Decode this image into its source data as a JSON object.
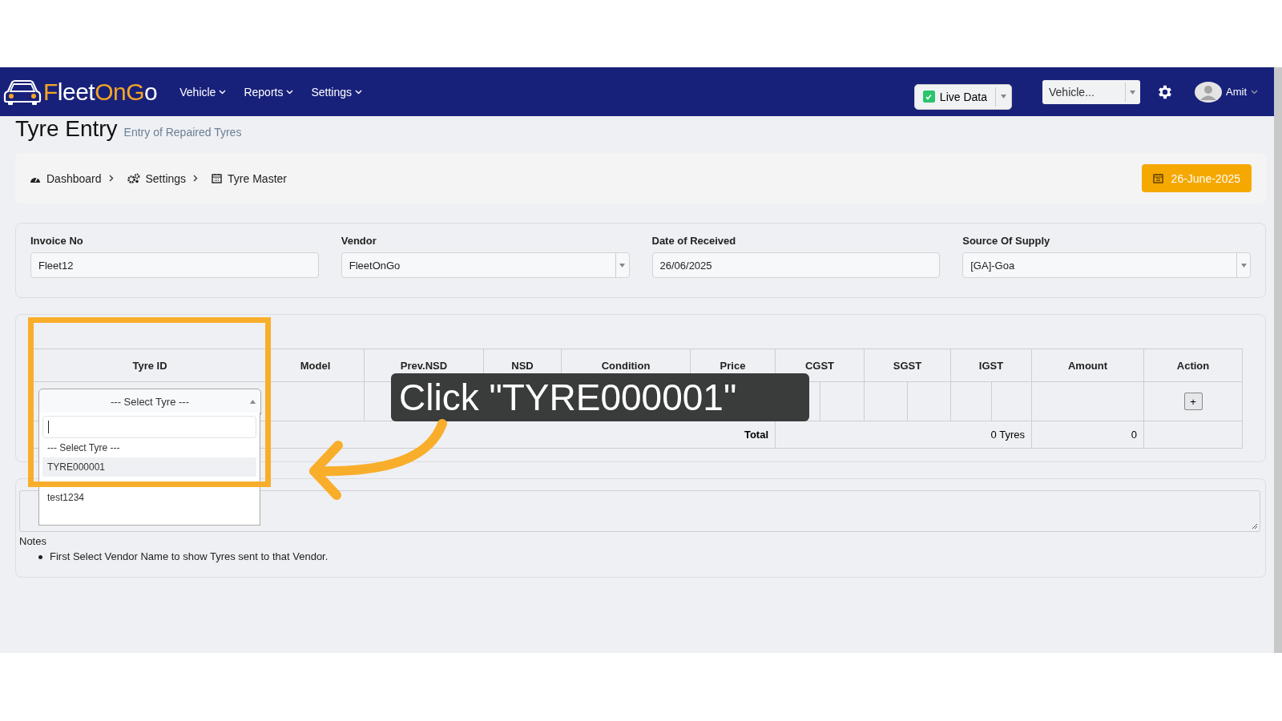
{
  "navbar": {
    "logo": [
      {
        "text": "F",
        "accent": true
      },
      {
        "text": "leet",
        "accent": false
      },
      {
        "text": "OnG",
        "accent": true
      },
      {
        "text": "o",
        "accent": false
      }
    ],
    "menu": [
      "Vehicle",
      "Reports",
      "Settings"
    ],
    "live_data": {
      "label": "Live Data",
      "checked": true
    },
    "vehicle_select": {
      "placeholder": "Vehicle..."
    },
    "user": {
      "name": "Amit"
    }
  },
  "page": {
    "title": "Tyre Entry",
    "subtitle": "Entry of Repaired Tyres"
  },
  "breadcrumb": [
    {
      "label": "Dashboard",
      "kind": "dashboard"
    },
    {
      "label": "Settings",
      "kind": "settings"
    },
    {
      "label": "Tyre Master",
      "kind": "calendar"
    }
  ],
  "date_button": "26-June-2025",
  "form": [
    {
      "label": "Invoice No",
      "kind": "input",
      "value": "Fleet12"
    },
    {
      "label": "Vendor",
      "kind": "select",
      "value": "FleetOnGo"
    },
    {
      "label": "Date of Received",
      "kind": "input",
      "value": "26/06/2025"
    },
    {
      "label": "Source Of Supply",
      "kind": "select",
      "value": "[GA]-Goa"
    }
  ],
  "table": {
    "columns": [
      "Tyre ID",
      "Model",
      "Prev.NSD",
      "NSD",
      "Condition",
      "Price"
    ],
    "tax_columns": [
      "CGST",
      "SGST",
      "IGST"
    ],
    "end_columns": [
      "Amount",
      "Action"
    ],
    "add_button": "+",
    "total": {
      "label": "Total",
      "tyres": "0 Tyres",
      "amount": "0"
    }
  },
  "tyre_select": {
    "value": "--- Select Tyre ---",
    "open": true,
    "options": [
      {
        "label": "--- Select Tyre ---",
        "highlighted": false
      },
      {
        "label": "TYRE000001",
        "highlighted": true
      },
      {
        "label": "test1234",
        "highlighted": false
      }
    ]
  },
  "notes": {
    "title": "Notes",
    "items": [
      "First Select Vendor Name to show Tyres sent to that Vendor."
    ]
  },
  "callout": {
    "text": "Click \"TYRE000001\""
  }
}
